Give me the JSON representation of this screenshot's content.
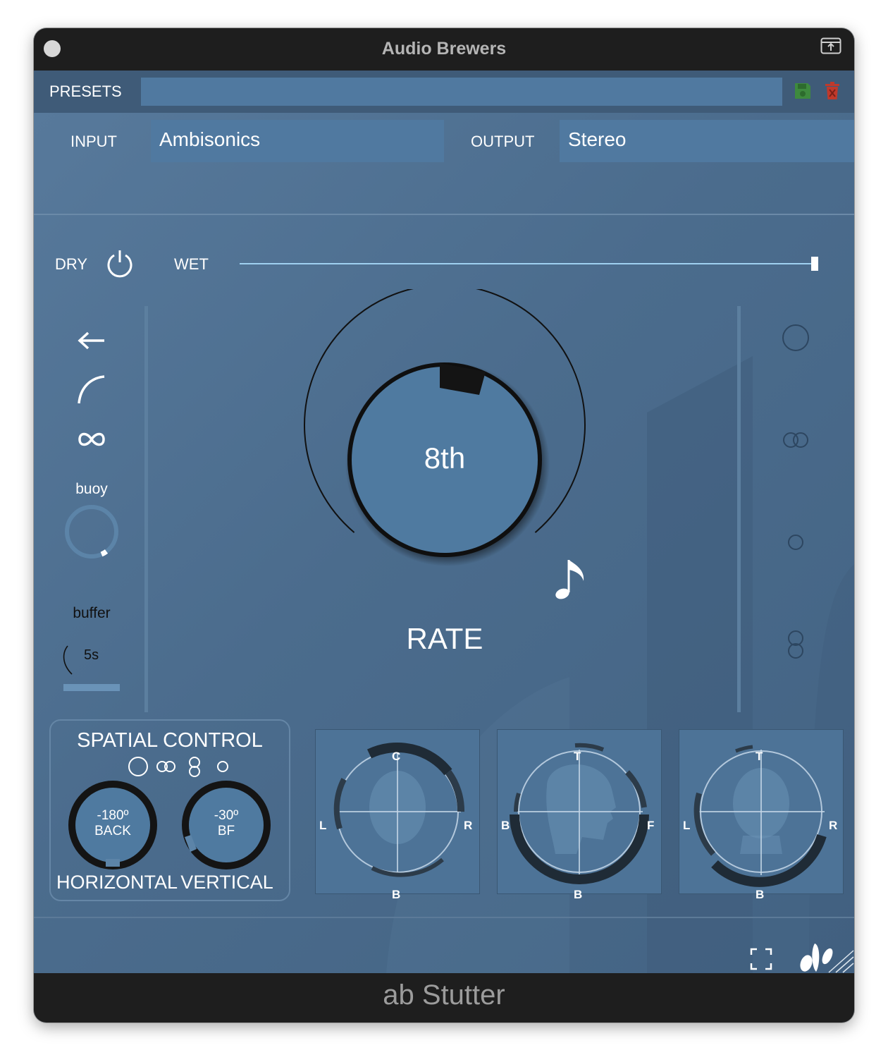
{
  "window": {
    "title": "Audio Brewers"
  },
  "presets": {
    "label": "PRESETS",
    "value": ""
  },
  "io": {
    "input_label": "INPUT",
    "input_value": "Ambisonics",
    "output_label": "OUTPUT",
    "output_value": "Stereo"
  },
  "mix": {
    "dry_label": "DRY",
    "wet_label": "WET",
    "wet_value": 1.0
  },
  "left_panel": {
    "icons": [
      "arrow-left-icon",
      "curve-icon",
      "infinity-icon"
    ],
    "buoy_label": "buoy",
    "buffer_label": "buffer",
    "buffer_value": "5s"
  },
  "rate_knob": {
    "value_text": "8th",
    "label": "RATE"
  },
  "right_panel": {
    "icons": [
      "omni-icon",
      "figure8-horizontal-icon",
      "small-circle-icon",
      "figure8-vertical-icon"
    ]
  },
  "spatial": {
    "title": "SPATIAL CONTROL",
    "horizontal": {
      "value": "-180º",
      "sub": "BACK",
      "label": "HORIZONTAL"
    },
    "vertical": {
      "value": "-30º",
      "sub": "BF",
      "label": "VERTICAL"
    }
  },
  "viz": [
    {
      "top": "C",
      "bottom": "B",
      "left": "L",
      "right": "R"
    },
    {
      "top": "T",
      "bottom": "B",
      "left": "B",
      "right": "F"
    },
    {
      "top": "T",
      "bottom": "B",
      "left": "L",
      "right": "R"
    }
  ],
  "footer": {
    "product": "ab Stutter"
  },
  "colors": {
    "bg": "#4a6a89",
    "field": "#5079a0",
    "dark": "#1e1e1e",
    "accent_light": "#9fd0f0",
    "save": "#3e8a3e",
    "delete": "#c0392b"
  }
}
